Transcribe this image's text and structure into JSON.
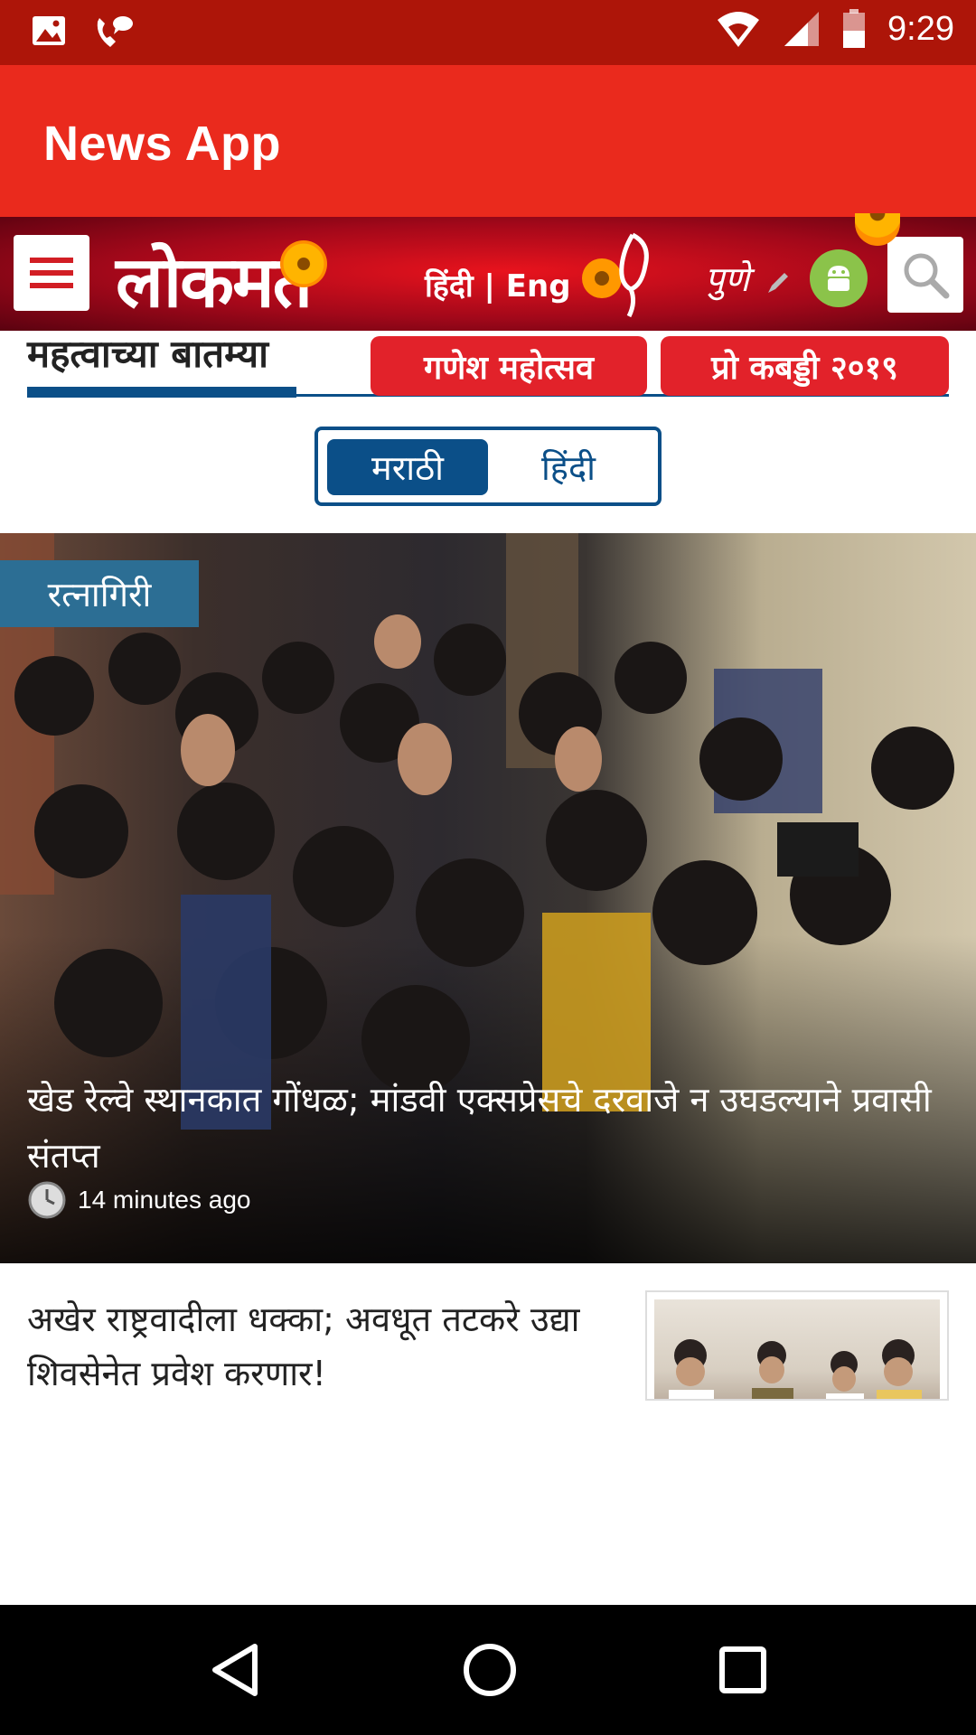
{
  "status_bar": {
    "time": "9:29",
    "left_icons": [
      "image-icon",
      "phone-icon"
    ],
    "right_icons": [
      "wifi-icon",
      "cellular-icon",
      "battery-icon"
    ]
  },
  "app_bar": {
    "title": "News App"
  },
  "lokmat_header": {
    "logo_text": "लोकमत",
    "lang_switch": "हिंदी | Eng",
    "city": "पुणे"
  },
  "section": {
    "title": "महत्वाच्या बातम्या",
    "pills": [
      "गणेश महोत्सव",
      "प्रो कबड्डी २०१९"
    ]
  },
  "language_toggle": {
    "options": [
      "मराठी",
      "हिंदी"
    ],
    "selected": "मराठी"
  },
  "hero_article": {
    "tag": "रत्नागिरी",
    "title": "खेड रेल्वे स्थानकात गोंधळ; मांडवी एक्सप्रेसचे दरवाजे न उघडल्याने प्रवासी संतप्त",
    "time": "14 minutes ago"
  },
  "article_2": {
    "title": "अखेर राष्ट्रवादीला धक्का; अवधूत तटकरे उद्या शिवसेनेत प्रवेश करणार!"
  },
  "colors": {
    "status_bar": "#ad1509",
    "app_bar": "#ea2a1d",
    "brand_blue": "#0b4f88",
    "pill_red": "#e2222a",
    "tag_blue": "#2c6e94"
  }
}
